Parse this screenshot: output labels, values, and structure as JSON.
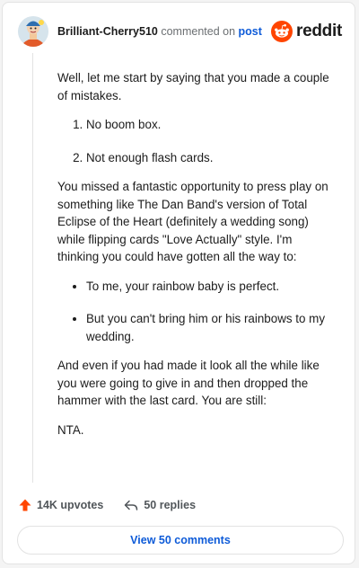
{
  "header": {
    "username": "Brilliant-Cherry510",
    "commented_text": "commented on",
    "post_link": "post",
    "logo_text": "reddit"
  },
  "comment": {
    "intro": "Well, let me start by saying that you made a couple of mistakes.",
    "mistakes": [
      "No boom box.",
      "Not enough flash cards."
    ],
    "paragraph2": "You missed a fantastic opportunity to press play on something like The Dan Band's version of Total Eclipse of the Heart (definitely a wedding song) while flipping cards \"Love Actually\" style. I'm thinking you could have gotten all the way to:",
    "cards": [
      "To me, your rainbow baby is perfect.",
      "But you can't bring him or his rainbows to my wedding."
    ],
    "paragraph3": "And even if you had made it look all the while like you were going to give in and then dropped the hammer with the last card. You are still:",
    "verdict": "NTA."
  },
  "actions": {
    "upvotes": "14K upvotes",
    "replies": "50 replies",
    "view_comments": "View 50 comments"
  },
  "colors": {
    "accent": "#ff4500",
    "link": "#0e5bd8"
  }
}
